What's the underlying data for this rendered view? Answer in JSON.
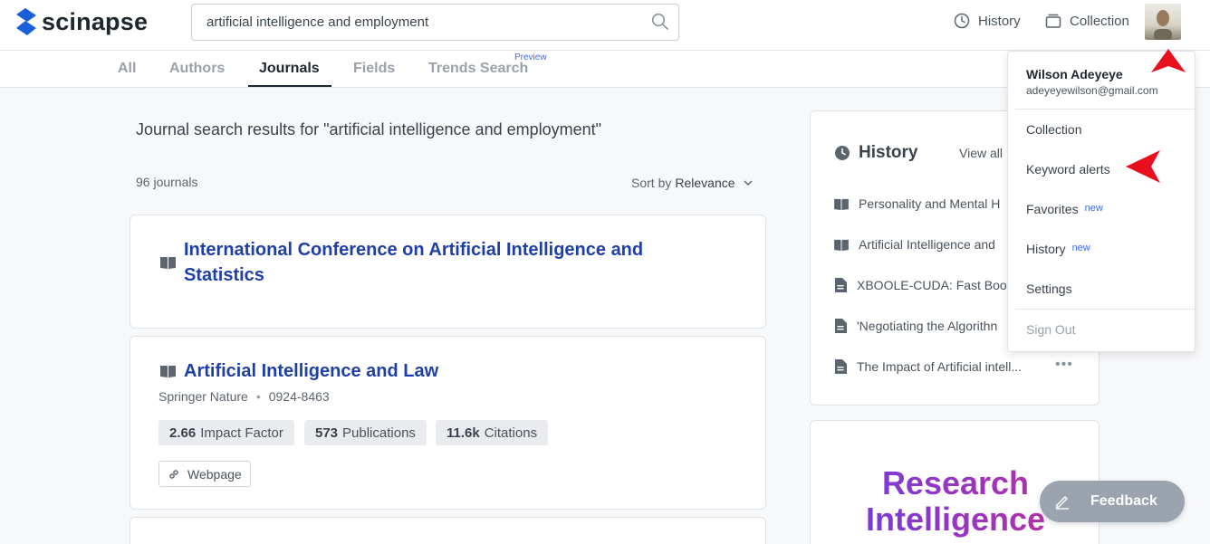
{
  "header": {
    "logo_text": "scinapse",
    "search": {
      "value": "artificial intelligence and employment",
      "placeholder": ""
    },
    "history_label": "History",
    "collection_label": "Collection"
  },
  "tabs": [
    {
      "label": "All"
    },
    {
      "label": "Authors"
    },
    {
      "label": "Journals",
      "active": true
    },
    {
      "label": "Fields"
    },
    {
      "label": "Trends Search",
      "badge": "Preview"
    }
  ],
  "results": {
    "title": "Journal search results for \"artificial intelligence and employment\"",
    "count": "96 journals",
    "sort_prefix": "Sort by",
    "sort_value": "Relevance"
  },
  "journals": [
    {
      "title": "International Conference on Artificial Intelligence and Statistics"
    },
    {
      "title": "Artificial Intelligence and Law",
      "publisher": "Springer Nature",
      "issn": "0924-8463",
      "metrics": [
        {
          "value": "2.66",
          "label": "Impact Factor"
        },
        {
          "value": "573",
          "label": "Publications"
        },
        {
          "value": "11.6k",
          "label": "Citations"
        }
      ],
      "webpage_label": "Webpage"
    }
  ],
  "history_panel": {
    "title": "History",
    "view_all": "View all",
    "items": [
      {
        "icon": "book-icon",
        "text": "Personality and Mental H"
      },
      {
        "icon": "book-icon",
        "text": "Artificial Intelligence and"
      },
      {
        "icon": "document-icon",
        "text": "XBOOLE-CUDA: Fast Boo"
      },
      {
        "icon": "document-icon",
        "text": "'Negotiating the Algorithn"
      },
      {
        "icon": "document-icon",
        "text": "The Impact of Artificial intell..."
      }
    ],
    "more": "•••"
  },
  "promo": {
    "line1": "Research",
    "line2": "Intelligence"
  },
  "user_menu": {
    "name": "Wilson Adeyeye",
    "email": "adeyeyewilson@gmail.com",
    "items": [
      {
        "label": "Collection"
      },
      {
        "label": "Keyword alerts"
      },
      {
        "label": "Favorites",
        "badge": "new"
      },
      {
        "label": "History",
        "badge": "new"
      },
      {
        "label": "Settings"
      }
    ],
    "sign_out": "Sign Out"
  },
  "feedback_label": "Feedback",
  "colors": {
    "brand": "#1a5ed8",
    "link": "#1e3fa8",
    "accent_badge": "#3e6be0",
    "annotation_arrow": "#e8101e"
  }
}
